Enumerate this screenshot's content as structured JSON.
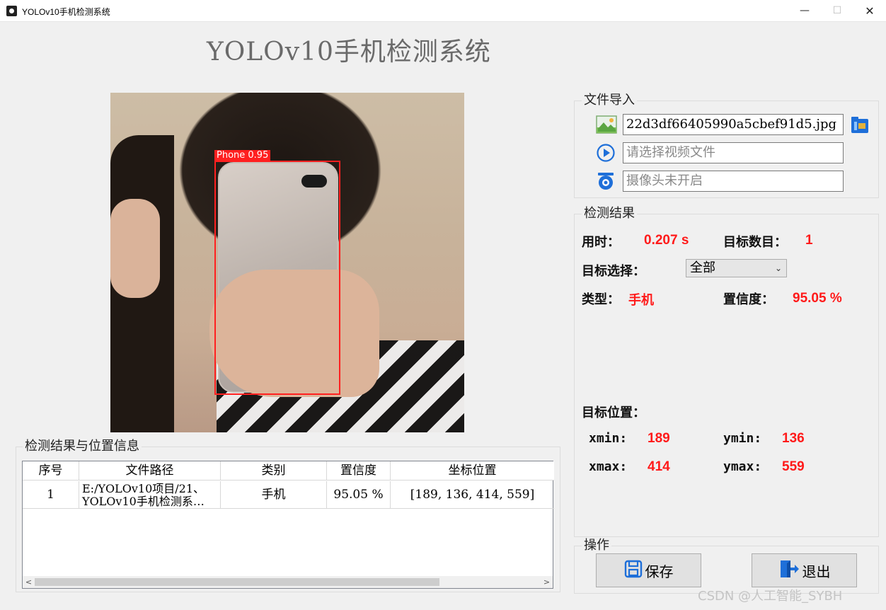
{
  "window": {
    "title": "YOLOv10手机检测系统",
    "minimize": "—",
    "maximize": "☐",
    "close": "✕"
  },
  "header": {
    "title": "YOLOv10手机检测系统"
  },
  "image": {
    "detection_label": "Phone  0.95"
  },
  "file_import": {
    "title": "文件导入",
    "image_file": "22d3df66405990a5cbef91d5.jpg",
    "video_placeholder": "请选择视频文件",
    "camera_placeholder": "摄像头未开启"
  },
  "results": {
    "title": "检测结果",
    "time_label": "用时：",
    "time_value": "0.207 s",
    "count_label": "目标数目：",
    "count_value": "1",
    "select_label": "目标选择：",
    "select_value": "全部",
    "type_label": "类型：",
    "type_value": "手机",
    "conf_label": "置信度：",
    "conf_value": "95.05 %",
    "position_label": "目标位置：",
    "xmin_label": "xmin:",
    "xmin_value": "189",
    "ymin_label": "ymin:",
    "ymin_value": "136",
    "xmax_label": "xmax:",
    "xmax_value": "414",
    "ymax_label": "ymax:",
    "ymax_value": "559"
  },
  "table": {
    "title": "检测结果与位置信息",
    "columns": [
      "序号",
      "文件路径",
      "类别",
      "置信度",
      "坐标位置"
    ],
    "rows": [
      {
        "index": "1",
        "path_line1": "E:/YOLOv10项目/21、",
        "path_line2": "YOLOv10手机检测系…",
        "class": "手机",
        "conf": "95.05 %",
        "coords": "[189, 136, 414, 559]"
      }
    ],
    "scroll_left": "<",
    "scroll_right": ">"
  },
  "actions": {
    "title": "操作",
    "save": "保存",
    "exit": "退出"
  },
  "watermark": "CSDN @人工智能_SYBH",
  "colors": {
    "accent_red": "#ff1a1a",
    "bbox": "#ff2020",
    "icon_blue": "#1e6fd9"
  }
}
